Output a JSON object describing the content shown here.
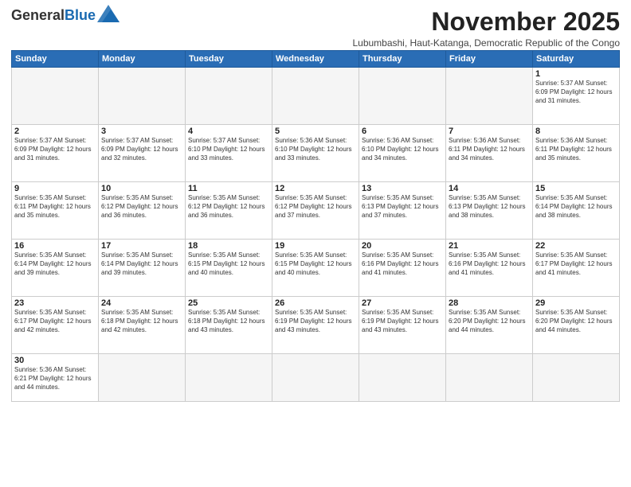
{
  "logo": {
    "line1": "General",
    "line2": "Blue"
  },
  "title": "November 2025",
  "subtitle": "Lubumbashi, Haut-Katanga, Democratic Republic of the Congo",
  "days_header": [
    "Sunday",
    "Monday",
    "Tuesday",
    "Wednesday",
    "Thursday",
    "Friday",
    "Saturday"
  ],
  "weeks": [
    [
      {
        "day": "",
        "info": ""
      },
      {
        "day": "",
        "info": ""
      },
      {
        "day": "",
        "info": ""
      },
      {
        "day": "",
        "info": ""
      },
      {
        "day": "",
        "info": ""
      },
      {
        "day": "",
        "info": ""
      },
      {
        "day": "1",
        "info": "Sunrise: 5:37 AM\nSunset: 6:09 PM\nDaylight: 12 hours and 31 minutes."
      }
    ],
    [
      {
        "day": "2",
        "info": "Sunrise: 5:37 AM\nSunset: 6:09 PM\nDaylight: 12 hours and 31 minutes."
      },
      {
        "day": "3",
        "info": "Sunrise: 5:37 AM\nSunset: 6:09 PM\nDaylight: 12 hours and 32 minutes."
      },
      {
        "day": "4",
        "info": "Sunrise: 5:37 AM\nSunset: 6:10 PM\nDaylight: 12 hours and 33 minutes."
      },
      {
        "day": "5",
        "info": "Sunrise: 5:36 AM\nSunset: 6:10 PM\nDaylight: 12 hours and 33 minutes."
      },
      {
        "day": "6",
        "info": "Sunrise: 5:36 AM\nSunset: 6:10 PM\nDaylight: 12 hours and 34 minutes."
      },
      {
        "day": "7",
        "info": "Sunrise: 5:36 AM\nSunset: 6:11 PM\nDaylight: 12 hours and 34 minutes."
      },
      {
        "day": "8",
        "info": "Sunrise: 5:36 AM\nSunset: 6:11 PM\nDaylight: 12 hours and 35 minutes."
      }
    ],
    [
      {
        "day": "9",
        "info": "Sunrise: 5:35 AM\nSunset: 6:11 PM\nDaylight: 12 hours and 35 minutes."
      },
      {
        "day": "10",
        "info": "Sunrise: 5:35 AM\nSunset: 6:12 PM\nDaylight: 12 hours and 36 minutes."
      },
      {
        "day": "11",
        "info": "Sunrise: 5:35 AM\nSunset: 6:12 PM\nDaylight: 12 hours and 36 minutes."
      },
      {
        "day": "12",
        "info": "Sunrise: 5:35 AM\nSunset: 6:12 PM\nDaylight: 12 hours and 37 minutes."
      },
      {
        "day": "13",
        "info": "Sunrise: 5:35 AM\nSunset: 6:13 PM\nDaylight: 12 hours and 37 minutes."
      },
      {
        "day": "14",
        "info": "Sunrise: 5:35 AM\nSunset: 6:13 PM\nDaylight: 12 hours and 38 minutes."
      },
      {
        "day": "15",
        "info": "Sunrise: 5:35 AM\nSunset: 6:14 PM\nDaylight: 12 hours and 38 minutes."
      }
    ],
    [
      {
        "day": "16",
        "info": "Sunrise: 5:35 AM\nSunset: 6:14 PM\nDaylight: 12 hours and 39 minutes."
      },
      {
        "day": "17",
        "info": "Sunrise: 5:35 AM\nSunset: 6:14 PM\nDaylight: 12 hours and 39 minutes."
      },
      {
        "day": "18",
        "info": "Sunrise: 5:35 AM\nSunset: 6:15 PM\nDaylight: 12 hours and 40 minutes."
      },
      {
        "day": "19",
        "info": "Sunrise: 5:35 AM\nSunset: 6:15 PM\nDaylight: 12 hours and 40 minutes."
      },
      {
        "day": "20",
        "info": "Sunrise: 5:35 AM\nSunset: 6:16 PM\nDaylight: 12 hours and 41 minutes."
      },
      {
        "day": "21",
        "info": "Sunrise: 5:35 AM\nSunset: 6:16 PM\nDaylight: 12 hours and 41 minutes."
      },
      {
        "day": "22",
        "info": "Sunrise: 5:35 AM\nSunset: 6:17 PM\nDaylight: 12 hours and 41 minutes."
      }
    ],
    [
      {
        "day": "23",
        "info": "Sunrise: 5:35 AM\nSunset: 6:17 PM\nDaylight: 12 hours and 42 minutes."
      },
      {
        "day": "24",
        "info": "Sunrise: 5:35 AM\nSunset: 6:18 PM\nDaylight: 12 hours and 42 minutes."
      },
      {
        "day": "25",
        "info": "Sunrise: 5:35 AM\nSunset: 6:18 PM\nDaylight: 12 hours and 43 minutes."
      },
      {
        "day": "26",
        "info": "Sunrise: 5:35 AM\nSunset: 6:19 PM\nDaylight: 12 hours and 43 minutes."
      },
      {
        "day": "27",
        "info": "Sunrise: 5:35 AM\nSunset: 6:19 PM\nDaylight: 12 hours and 43 minutes."
      },
      {
        "day": "28",
        "info": "Sunrise: 5:35 AM\nSunset: 6:20 PM\nDaylight: 12 hours and 44 minutes."
      },
      {
        "day": "29",
        "info": "Sunrise: 5:35 AM\nSunset: 6:20 PM\nDaylight: 12 hours and 44 minutes."
      }
    ],
    [
      {
        "day": "30",
        "info": "Sunrise: 5:36 AM\nSunset: 6:21 PM\nDaylight: 12 hours and 44 minutes."
      },
      {
        "day": "",
        "info": ""
      },
      {
        "day": "",
        "info": ""
      },
      {
        "day": "",
        "info": ""
      },
      {
        "day": "",
        "info": ""
      },
      {
        "day": "",
        "info": ""
      },
      {
        "day": "",
        "info": ""
      }
    ]
  ]
}
